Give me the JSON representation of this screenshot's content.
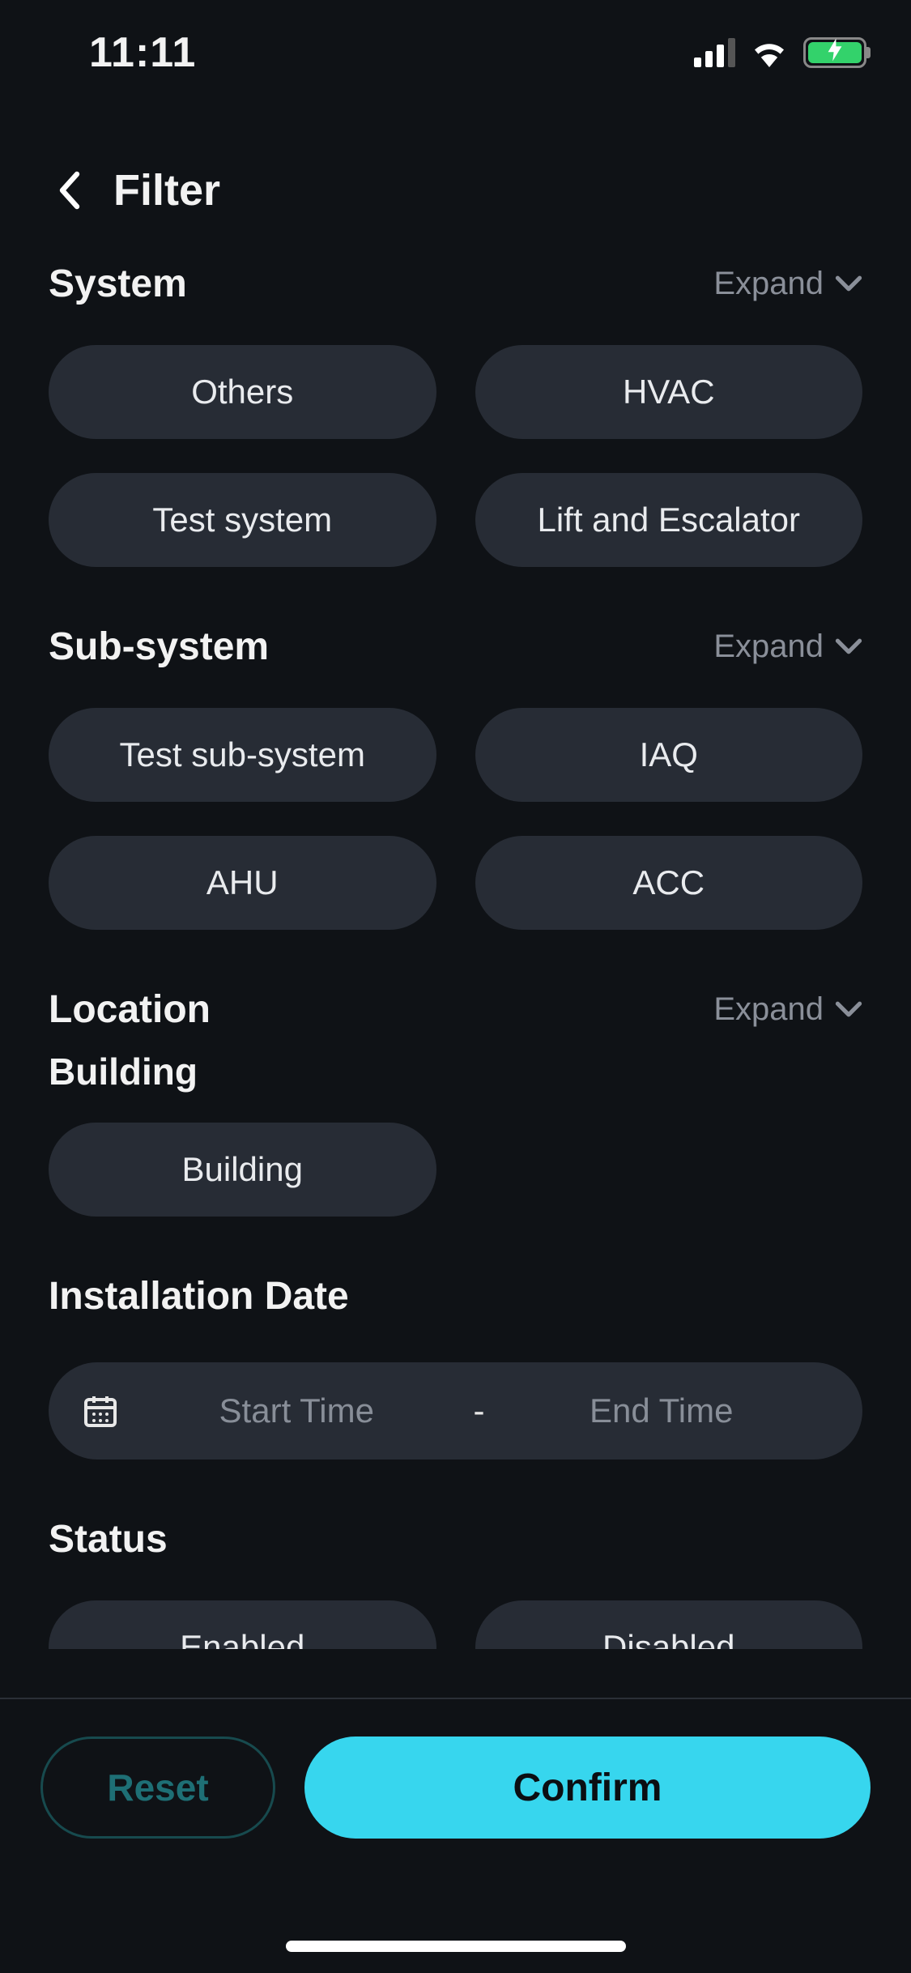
{
  "status_bar": {
    "time": "11:11"
  },
  "header": {
    "title": "Filter"
  },
  "sections": {
    "system": {
      "title": "System",
      "expand_label": "Expand",
      "chips": [
        "Others",
        "HVAC",
        "Test system",
        "Lift and Escalator"
      ]
    },
    "subsystem": {
      "title": "Sub-system",
      "expand_label": "Expand",
      "chips": [
        "Test sub-system",
        "IAQ",
        "AHU",
        "ACC"
      ]
    },
    "location": {
      "title": "Location",
      "expand_label": "Expand",
      "sub_title": "Building",
      "chips": [
        "Building"
      ]
    },
    "installation_date": {
      "title": "Installation Date",
      "start_placeholder": "Start Time",
      "separator": "-",
      "end_placeholder": "End Time"
    },
    "status": {
      "title": "Status",
      "chips": [
        "Enabled",
        "Disabled"
      ]
    }
  },
  "footer": {
    "reset_label": "Reset",
    "confirm_label": "Confirm"
  }
}
